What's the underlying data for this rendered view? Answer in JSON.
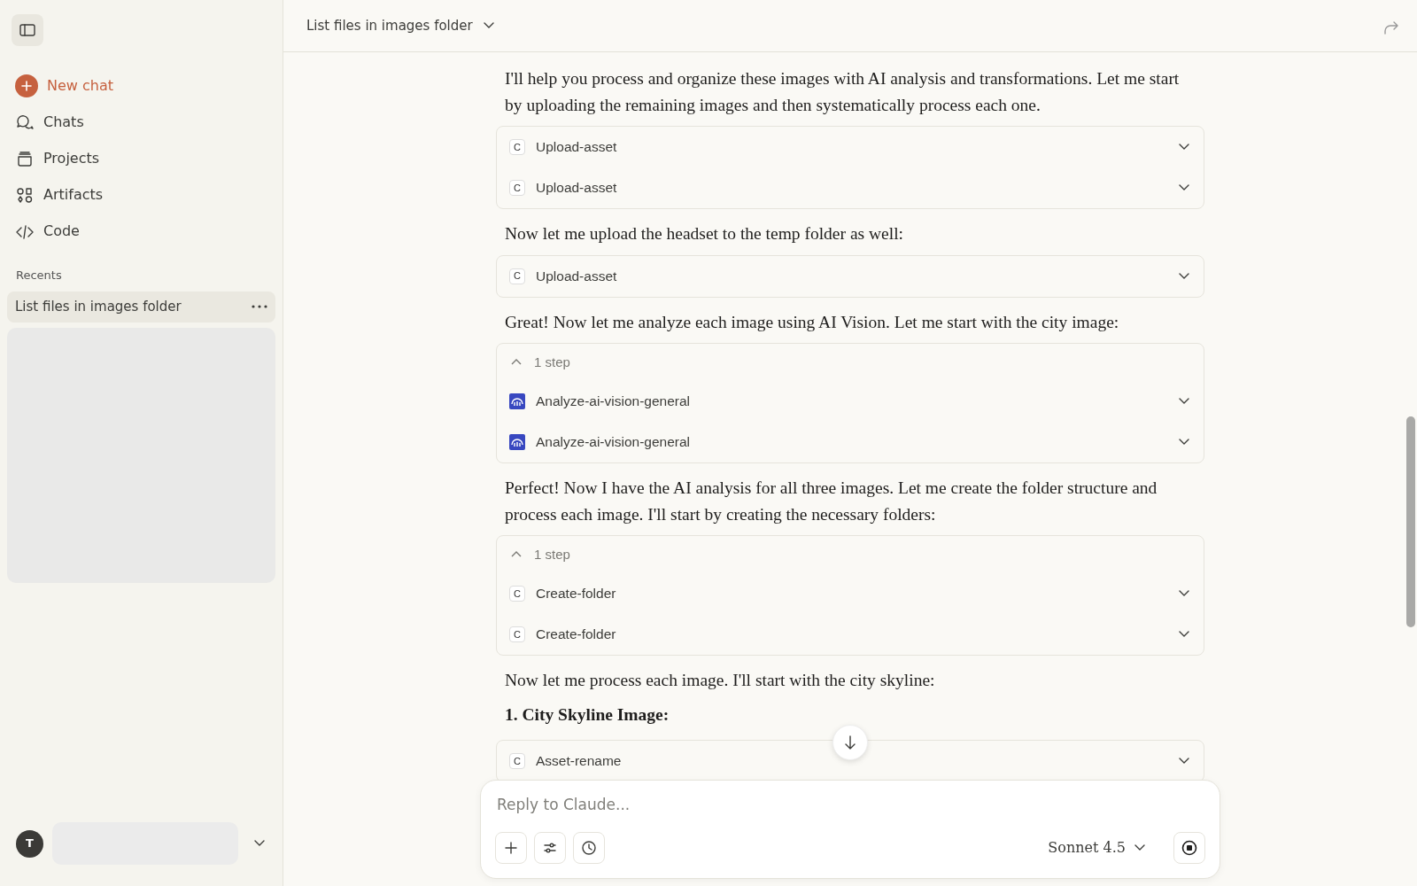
{
  "sidebar": {
    "nav": [
      {
        "kind": "new",
        "label": "New chat"
      },
      {
        "kind": "chats",
        "label": "Chats"
      },
      {
        "kind": "projects",
        "label": "Projects"
      },
      {
        "kind": "artifacts",
        "label": "Artifacts"
      },
      {
        "kind": "code",
        "label": "Code"
      }
    ],
    "recents_label": "Recents",
    "recents": [
      {
        "title": "List files in images folder",
        "selected": true
      }
    ],
    "user": {
      "initial": "T"
    }
  },
  "header": {
    "title": "List files in images folder"
  },
  "messages": [
    {
      "kind": "text",
      "text": "I'll help you process and organize these images with AI analysis and transformations. Let me start by uploading the remaining images and then systematically process each one."
    },
    {
      "kind": "tools",
      "items": [
        {
          "kind": "letter",
          "badge": "C",
          "name": "Upload-asset"
        },
        {
          "kind": "letter",
          "badge": "C",
          "name": "Upload-asset"
        }
      ]
    },
    {
      "kind": "text",
      "text": "Now let me upload the headset to the temp folder as well:"
    },
    {
      "kind": "tools",
      "items": [
        {
          "kind": "letter",
          "badge": "C",
          "name": "Upload-asset"
        }
      ]
    },
    {
      "kind": "text",
      "text": "Great! Now let me analyze each image using AI Vision. Let me start with the city image:"
    },
    {
      "kind": "tools",
      "steps": "1 step",
      "expanded": true,
      "items": [
        {
          "kind": "vision",
          "name": "Analyze-ai-vision-general"
        },
        {
          "kind": "vision",
          "name": "Analyze-ai-vision-general"
        }
      ]
    },
    {
      "kind": "text",
      "text": "Perfect! Now I have the AI analysis for all three images. Let me create the folder structure and process each image. I'll start by creating the necessary folders:"
    },
    {
      "kind": "tools",
      "steps": "1 step",
      "expanded": true,
      "items": [
        {
          "kind": "letter",
          "badge": "C",
          "name": "Create-folder"
        },
        {
          "kind": "letter",
          "badge": "C",
          "name": "Create-folder"
        }
      ]
    },
    {
      "kind": "text",
      "text": "Now let me process each image. I'll start with the city skyline:"
    },
    {
      "kind": "heading",
      "text": "1. City Skyline Image:"
    },
    {
      "kind": "tools",
      "items": [
        {
          "kind": "letter",
          "badge": "C",
          "name": "Asset-rename"
        }
      ]
    }
  ],
  "composer": {
    "placeholder": "Reply to Claude...",
    "model": "Sonnet 4.5"
  }
}
